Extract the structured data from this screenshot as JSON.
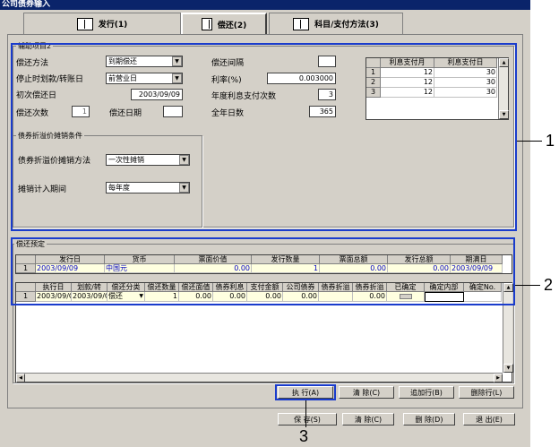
{
  "window": {
    "title": "公司债券输入"
  },
  "tabs": [
    {
      "label": "发行(1)",
      "icon": "book-icon"
    },
    {
      "label": "偿还(2)",
      "icon": "ledger-icon"
    },
    {
      "label": "科目/支付方法(3)",
      "icon": "card-icon"
    }
  ],
  "aux": {
    "title": "辅助项目2",
    "repay_method_label": "偿还方法",
    "repay_method_value": "到期偿还",
    "stop_label": "停止时划款/转账日",
    "stop_value": "前营业日",
    "first_date_label": "初次偿还日",
    "first_date_value": "2003/09/09",
    "times_label": "偿还次数",
    "times_value": "1",
    "repay_date_label": "偿还日期",
    "repay_date_value": "",
    "interval_label": "偿还间隔",
    "interval_value": "",
    "rate_label": "利率(%)",
    "rate_value": "0.003000",
    "annual_label": "年度利息支付次数",
    "annual_value": "3",
    "days_label": "全年日数",
    "days_value": "365"
  },
  "interest_table": {
    "headers": [
      "利息支付月",
      "利息支付日"
    ],
    "rows": [
      [
        "1",
        "12",
        "30"
      ],
      [
        "2",
        "12",
        "30"
      ],
      [
        "3",
        "12",
        "30"
      ]
    ]
  },
  "discount": {
    "title": "债券折溢价摊销条件",
    "method_label": "债券折溢价摊销方法",
    "method_value": "一次性摊销",
    "period_label": "摊销计入期间",
    "period_value": "每年度"
  },
  "plan": {
    "title": "偿还预定",
    "top_headers": [
      "发行日",
      "货币",
      "票面价值",
      "发行数量",
      "票面总额",
      "发行总额",
      "期满日"
    ],
    "top_row": [
      "1",
      "2003/09/09",
      "中国元",
      "0.00",
      "1",
      "0.00",
      "0.00",
      "2003/09/09"
    ],
    "bottom_headers": [
      "执行日",
      "划款/转",
      "偿还分类",
      "偿还数量",
      "偿还面值",
      "债券利息",
      "支付金额",
      "公司债券",
      "债券折溢",
      "债券折溢",
      "已确定",
      "确定内部",
      "确定No."
    ],
    "bottom_row": [
      "1",
      "2003/09/C",
      "2003/09/C",
      "偿还",
      "1",
      "0.00",
      "0.00",
      "0.00",
      "0.00",
      "",
      "0.00",
      "",
      ""
    ]
  },
  "row_buttons": [
    "执 行(A)",
    "清 除(C)",
    "追加行(B)",
    "删除行(L)"
  ],
  "footer_buttons": [
    "保 存(S)",
    "清 除(C)",
    "删 除(D)",
    "退 出(E)"
  ],
  "callouts": [
    "1",
    "2",
    "3"
  ],
  "colors": {
    "accent": "#1a3ccc",
    "titlebar": "#0a246a",
    "face": "#d4d0c8"
  }
}
